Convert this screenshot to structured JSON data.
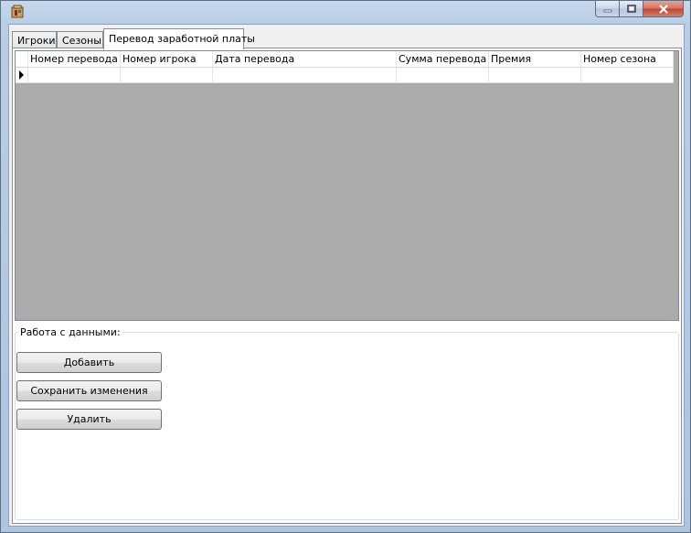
{
  "window": {
    "app_icon": "app-icon",
    "controls": [
      "minimize-icon",
      "maximize-icon",
      "close-icon"
    ]
  },
  "tabs": [
    {
      "label": "Игроки",
      "active": false
    },
    {
      "label": "Сезоны",
      "active": false
    },
    {
      "label": "Перевод заработной платы",
      "active": true
    }
  ],
  "grid": {
    "columns": [
      "Номер перевода",
      "Номер игрока",
      "Дата перевода",
      "Сумма перевода",
      "Премия",
      "Номер сезона"
    ],
    "rows": [
      [
        "",
        "",
        "",
        "",
        "",
        ""
      ]
    ],
    "current_row_indicator": "row-pointer-icon"
  },
  "data_group": {
    "legend": "Работа с данными:",
    "add_label": "Добавить",
    "save_label": "Сохранить изменения",
    "delete_label": "Удалить"
  }
}
